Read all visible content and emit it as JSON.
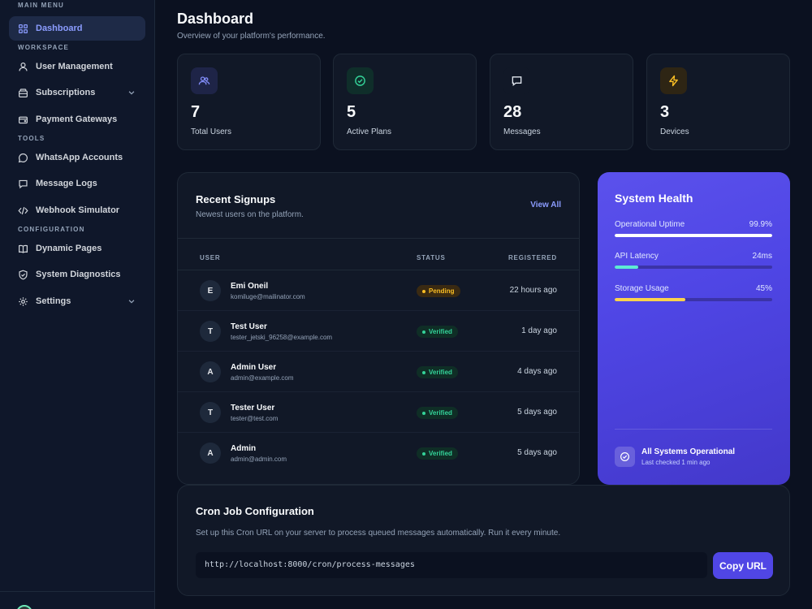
{
  "sidebar": {
    "sections": {
      "main": "MAIN MENU",
      "workspace": "WORKSPACE",
      "tools": "TOOLS",
      "configuration": "CONFIGURATION"
    },
    "items": [
      {
        "label": "Dashboard",
        "icon": "grid-icon"
      },
      {
        "label": "User Management",
        "icon": "users-icon"
      },
      {
        "label": "Subscriptions",
        "icon": "box-icon"
      },
      {
        "label": "Payment Gateways",
        "icon": "wallet-icon"
      },
      {
        "label": "WhatsApp Accounts",
        "icon": "chat-icon"
      },
      {
        "label": "Message Logs",
        "icon": "message-icon"
      },
      {
        "label": "Webhook Simulator",
        "icon": "code-icon"
      },
      {
        "label": "Dynamic Pages",
        "icon": "book-icon"
      },
      {
        "label": "System Diagnostics",
        "icon": "shield-icon"
      },
      {
        "label": "Settings",
        "icon": "gear-icon"
      }
    ]
  },
  "header": {
    "title": "Dashboard",
    "subtitle": "Overview of your platform's performance."
  },
  "stats": [
    {
      "value": "7",
      "label": "Total Users",
      "icon": "users-icon",
      "color": "#818cf8"
    },
    {
      "value": "5",
      "label": "Active Plans",
      "icon": "check-circle-icon",
      "color": "#34d399"
    },
    {
      "value": "28",
      "label": "Messages",
      "icon": "message-icon",
      "color": "#e2e8f0"
    },
    {
      "value": "3",
      "label": "Devices",
      "icon": "bolt-icon",
      "color": "#fbbf24"
    }
  ],
  "signups": {
    "title": "Recent Signups",
    "subtitle": "Newest users on the platform.",
    "view_all": "View All",
    "columns": [
      "USER",
      "STATUS",
      "REGISTERED"
    ],
    "rows": [
      {
        "initial": "E",
        "name": "Emi Oneil",
        "email": "komiluge@mailinator.com",
        "status": "Pending",
        "registered": "22 hours ago"
      },
      {
        "initial": "T",
        "name": "Test User",
        "email": "tester_jetski_96258@example.com",
        "status": "Verified",
        "registered": "1 day ago"
      },
      {
        "initial": "A",
        "name": "Admin User",
        "email": "admin@example.com",
        "status": "Verified",
        "registered": "4 days ago"
      },
      {
        "initial": "T",
        "name": "Tester User",
        "email": "tester@test.com",
        "status": "Verified",
        "registered": "5 days ago"
      },
      {
        "initial": "A",
        "name": "Admin",
        "email": "admin@admin.com",
        "status": "Verified",
        "registered": "5 days ago"
      }
    ]
  },
  "health": {
    "title": "System Health",
    "metrics": [
      {
        "label": "Operational Uptime",
        "value": "99.9%",
        "fraction": 0.999,
        "color": "#ffffff"
      },
      {
        "label": "API Latency",
        "value": "24ms",
        "fraction": 0.15,
        "color": "#5eead4"
      },
      {
        "label": "Storage Usage",
        "value": "45%",
        "fraction": 0.45,
        "color": "#fcd34d"
      }
    ],
    "status": "All Systems Operational",
    "last_checked": "Last checked 1 min ago"
  },
  "cron": {
    "title": "Cron Job Configuration",
    "description": "Set up this Cron URL on your server to process queued messages automatically. Run it every minute.",
    "url": "http://localhost:8000/cron/process-messages",
    "copy_label": "Copy URL"
  }
}
